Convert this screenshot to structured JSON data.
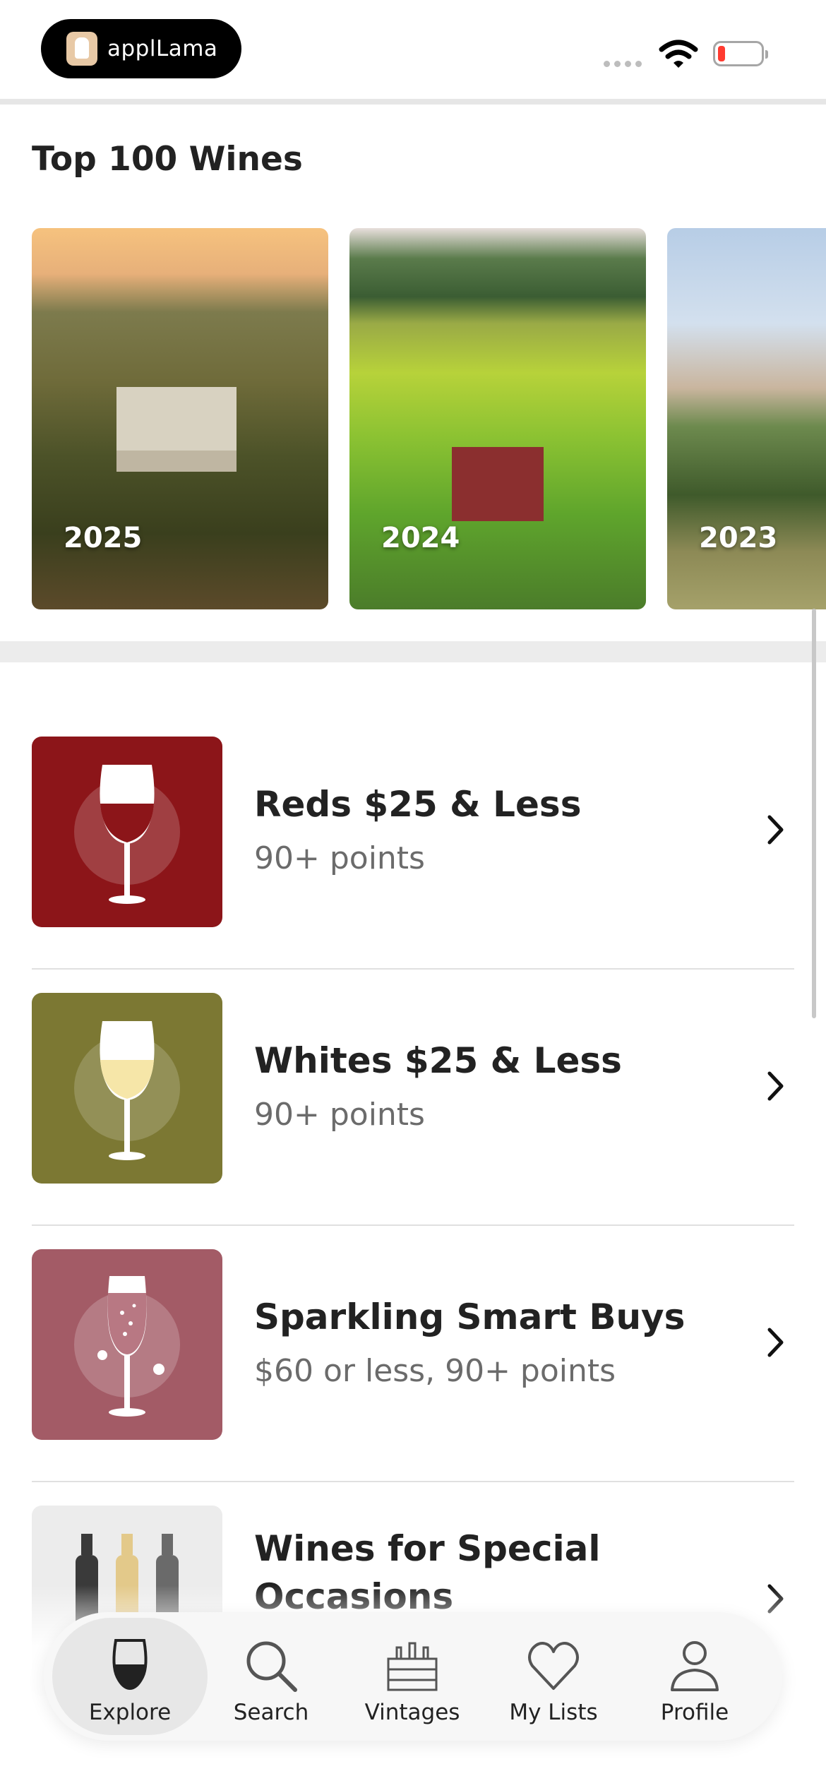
{
  "status_bar": {
    "app_badge": "applLama",
    "colors": {
      "battery_level": "#ff3b30"
    }
  },
  "section": {
    "title": "Top 100 Wines"
  },
  "carousel": [
    {
      "year": "2025"
    },
    {
      "year": "2024"
    },
    {
      "year": "2023"
    }
  ],
  "lists": [
    {
      "title": "Reds $25 & Less",
      "subtitle": "90+ points",
      "thumb_color": "#8c1519",
      "icon": "red-wine-glass-icon"
    },
    {
      "title": "Whites $25 & Less",
      "subtitle": "90+ points",
      "thumb_color": "#7c7833",
      "icon": "white-wine-glass-icon"
    },
    {
      "title": "Sparkling Smart Buys",
      "subtitle": "$60 or less, 90+ points",
      "thumb_color": "#a35b66",
      "icon": "sparkling-wine-glass-icon"
    },
    {
      "title": "Wines for Special Occasions",
      "subtitle": "",
      "thumb_color": "#ececec",
      "icon": "wine-bottles-icon"
    }
  ],
  "tabbar": {
    "tabs": [
      {
        "label": "Explore",
        "icon": "wine-glass-icon",
        "active": true
      },
      {
        "label": "Search",
        "icon": "search-icon",
        "active": false
      },
      {
        "label": "Vintages",
        "icon": "wine-crate-icon",
        "active": false
      },
      {
        "label": "My Lists",
        "icon": "heart-icon",
        "active": false
      },
      {
        "label": "Profile",
        "icon": "person-icon",
        "active": false
      }
    ]
  }
}
